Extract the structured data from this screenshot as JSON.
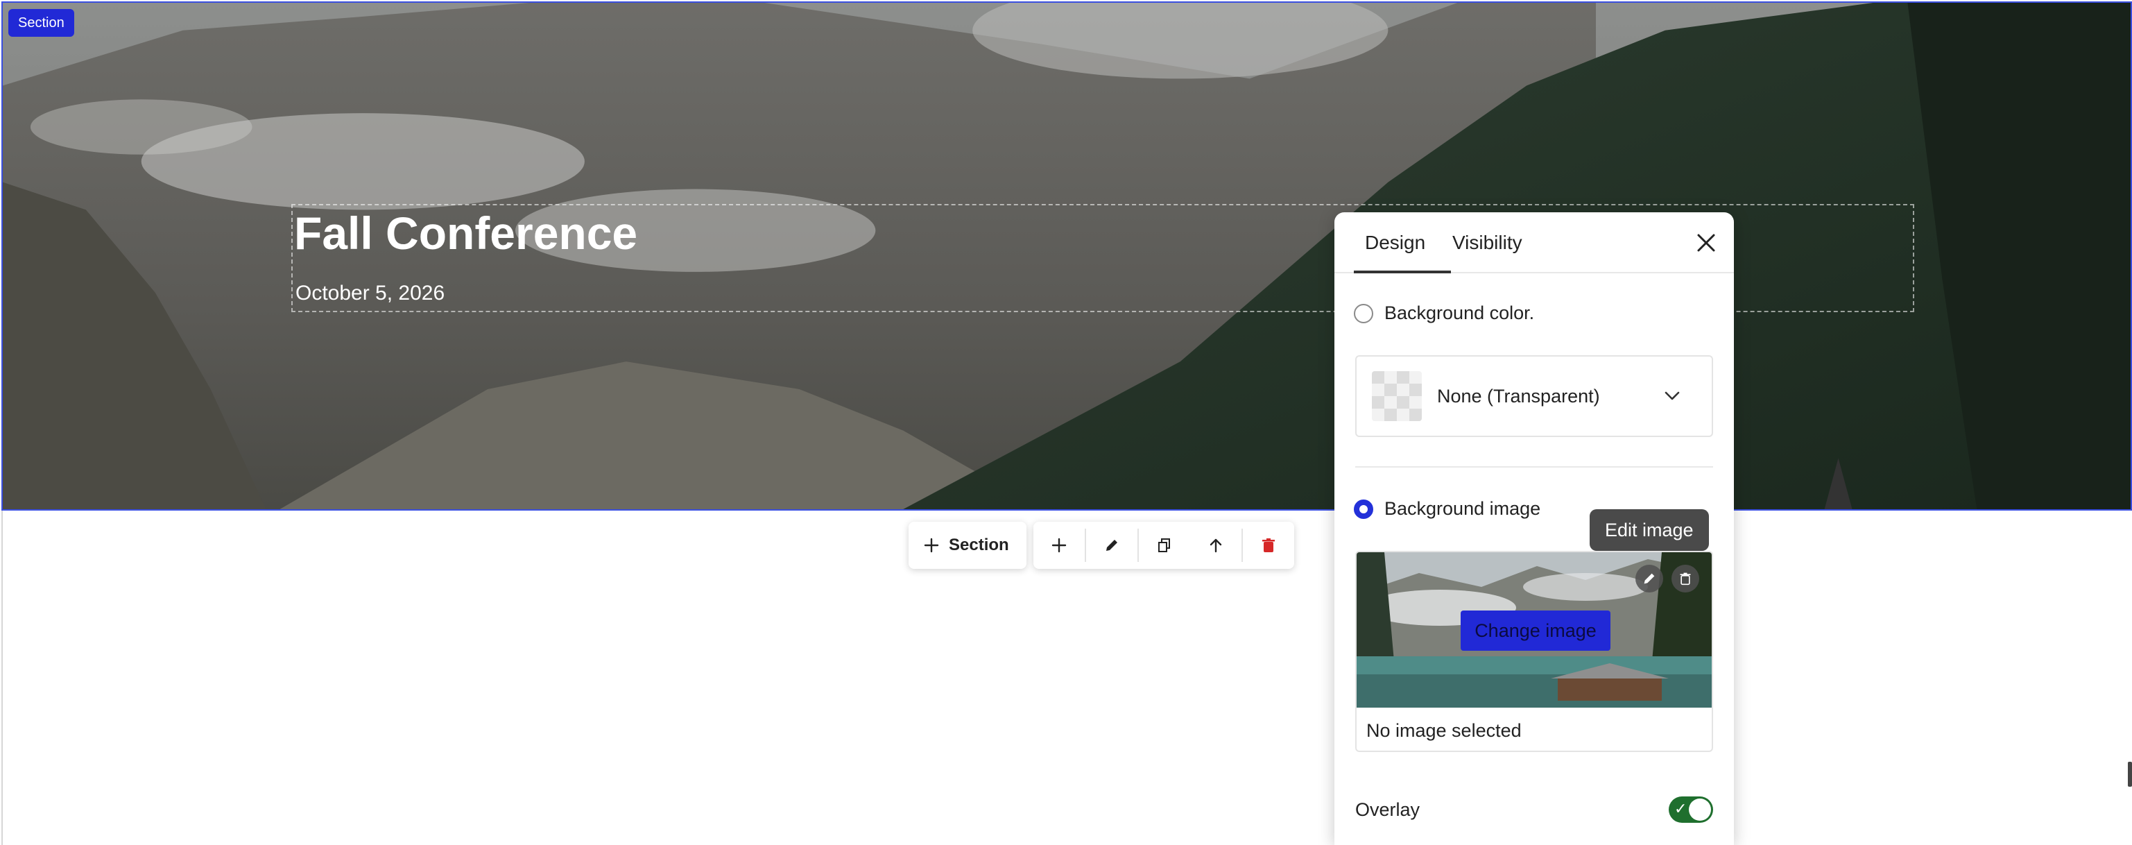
{
  "hero": {
    "section_tag": "Section",
    "title": "Fall Conference",
    "date": "October 5, 2026"
  },
  "toolbar": {
    "add_section_label": "Section",
    "actions": [
      "add-icon",
      "edit-icon",
      "duplicate-icon",
      "move-up-icon",
      "delete-icon"
    ]
  },
  "panel": {
    "tabs": [
      {
        "label": "Design",
        "active": true
      },
      {
        "label": "Visibility",
        "active": false
      }
    ],
    "background_color": {
      "label": "Background color.",
      "selected": false,
      "value": "None (Transparent)"
    },
    "background_image": {
      "label": "Background image",
      "selected": true,
      "change_button": "Change image",
      "caption": "No image selected",
      "tooltip": "Edit image"
    },
    "overlay": {
      "label": "Overlay",
      "enabled": true
    }
  },
  "colors": {
    "accent": "#2129d6",
    "toggle_on": "#1f6f2e",
    "delete": "#d62828"
  }
}
